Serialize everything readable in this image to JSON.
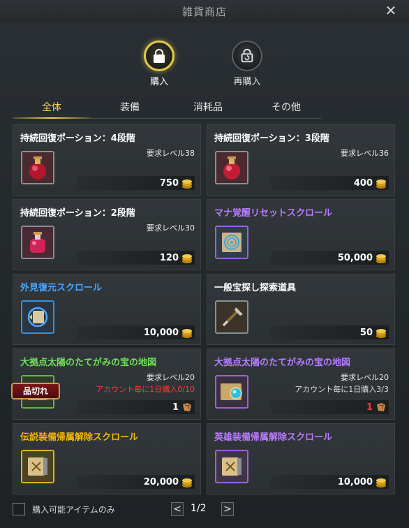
{
  "window": {
    "title": "雑貨商店"
  },
  "modes": [
    {
      "label": "購入",
      "icon": "shopping-bag-icon",
      "active": true
    },
    {
      "label": "再購入",
      "icon": "rebuy-bag-icon",
      "active": false
    }
  ],
  "tabs": [
    "全体",
    "装備",
    "消耗品",
    "その他"
  ],
  "items": [
    {
      "name": "持続回復ポーション：4段階",
      "name_color": "#ffffff",
      "level": "要求レベル38",
      "limit": "",
      "price": "750",
      "currency": "gold-coin-icon",
      "icon": "red-potion-icon"
    },
    {
      "name": "持続回復ポーション：3段階",
      "name_color": "#ffffff",
      "level": "要求レベル36",
      "limit": "",
      "price": "400",
      "currency": "gold-coin-icon",
      "icon": "red-potion-icon"
    },
    {
      "name": "持続回復ポーション：2段階",
      "name_color": "#ffffff",
      "level": "要求レベル30",
      "limit": "",
      "price": "120",
      "currency": "gold-coin-icon",
      "icon": "pink-potion-icon"
    },
    {
      "name": "マナ覚醒リセットスクロール",
      "name_color": "#b77cff",
      "level": "",
      "limit": "",
      "price": "50,000",
      "currency": "gold-coin-icon",
      "icon": "mana-scroll-icon"
    },
    {
      "name": "外見復元スクロール",
      "name_color": "#4aa8ff",
      "level": "",
      "limit": "",
      "price": "10,000",
      "currency": "gold-coin-icon",
      "icon": "restore-scroll-icon"
    },
    {
      "name": "一般宝探し探索道具",
      "name_color": "#ffffff",
      "level": "",
      "limit": "",
      "price": "50",
      "currency": "gold-coin-icon",
      "icon": "shovel-icon"
    },
    {
      "name": "大拠点太陽のたてがみの宝の地図",
      "name_color": "#6fe05a",
      "level": "要求レベル20",
      "limit": "アカウント毎に1日購入0/10",
      "limit_color": "#ff3b30",
      "price": "1",
      "currency": "map-token-icon",
      "icon": "treasure-map-icon",
      "soldout": "品切れ"
    },
    {
      "name": "大拠点太陽のたてがみの宝の地図",
      "name_color": "#b77cff",
      "level": "要求レベル20",
      "limit": "アカウント毎に1日購入3/3",
      "limit_color": "#d9d9d9",
      "price": "1",
      "price_color": "#ff3b30",
      "currency": "map-token-icon",
      "icon": "treasure-map-gem-icon"
    },
    {
      "name": "伝説装備帰属解除スクロール",
      "name_color": "#f2b705",
      "level": "",
      "limit": "",
      "price": "20,000",
      "currency": "gold-coin-icon",
      "icon": "legendary-unbind-scroll-icon"
    },
    {
      "name": "英雄装備帰属解除スクロール",
      "name_color": "#b77cff",
      "level": "",
      "limit": "",
      "price": "10,000",
      "currency": "gold-coin-icon",
      "icon": "hero-unbind-scroll-icon"
    }
  ],
  "footer": {
    "filter_label": "購入可能アイテムのみ",
    "page": "1/2",
    "prev": "<",
    "next": ">"
  }
}
